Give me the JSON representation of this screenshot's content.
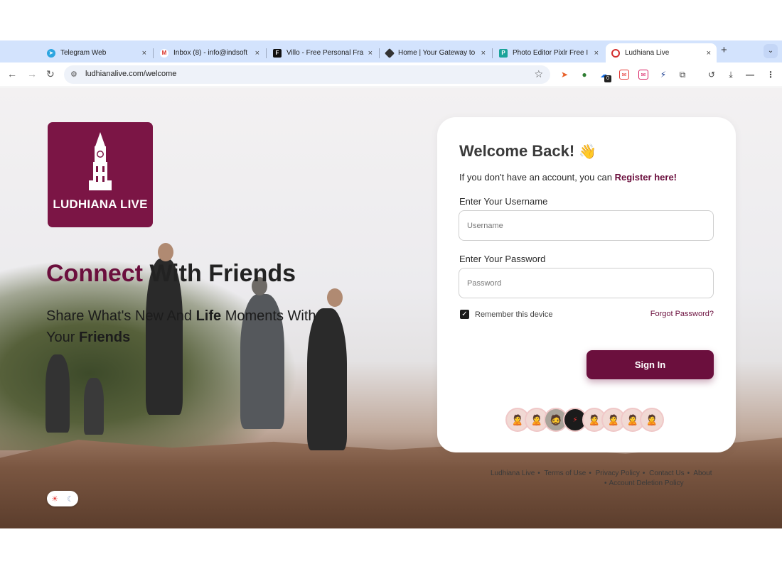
{
  "browser": {
    "tabs": [
      {
        "label": "Telegram Web",
        "icon": "telegram-icon",
        "active": false
      },
      {
        "label": "Inbox (8) - info@indsoft",
        "icon": "gmail-icon",
        "active": false
      },
      {
        "label": "Villo - Free Personal Fra",
        "icon": "framer-icon",
        "active": false
      },
      {
        "label": "Home | Your Gateway to",
        "icon": "diamond-icon",
        "active": false
      },
      {
        "label": "Photo Editor Pixlr Free I",
        "icon": "pixlr-icon",
        "active": false
      },
      {
        "label": "Ludhiana Live",
        "icon": "ludhiana-live-icon",
        "active": true
      }
    ],
    "close_glyph": "×",
    "new_tab_glyph": "+",
    "tab_menu_glyph": "⌄",
    "url": "ludhianalive.com/welcome",
    "extension_badge": "0"
  },
  "hero": {
    "logo_text": "LUDHIANA LIVE",
    "headline_accent": "Connect",
    "headline_rest": " With Friends",
    "sub_line1_a": "Share What's New And ",
    "sub_line1_b": "Life",
    "sub_line1_c": " Moments With",
    "sub_line2_a": "Your ",
    "sub_line2_b": "Friends"
  },
  "login": {
    "title": "Welcome Back!",
    "wave": "👋",
    "register_prefix": "If you don't have an account, you can ",
    "register_link": "Register here!",
    "username_label": "Enter Your Username",
    "username_placeholder": "Username",
    "password_label": "Enter Your Password",
    "password_placeholder": "Password",
    "remember_label": "Remember this device",
    "remember_checked": true,
    "forgot_label": "Forgot Password?",
    "signin_label": "Sign In"
  },
  "footer": {
    "links": [
      "Ludhiana Live",
      "Terms of Use",
      "Privacy Policy",
      "Contact Us",
      "About",
      "Account Deletion Policy"
    ]
  },
  "theme_toggle": {
    "sun": "☀",
    "moon": "☾"
  },
  "colors": {
    "brand": "#6b0f3d",
    "logo_bg": "#7b1545",
    "tabbar": "#d3e3fd"
  }
}
